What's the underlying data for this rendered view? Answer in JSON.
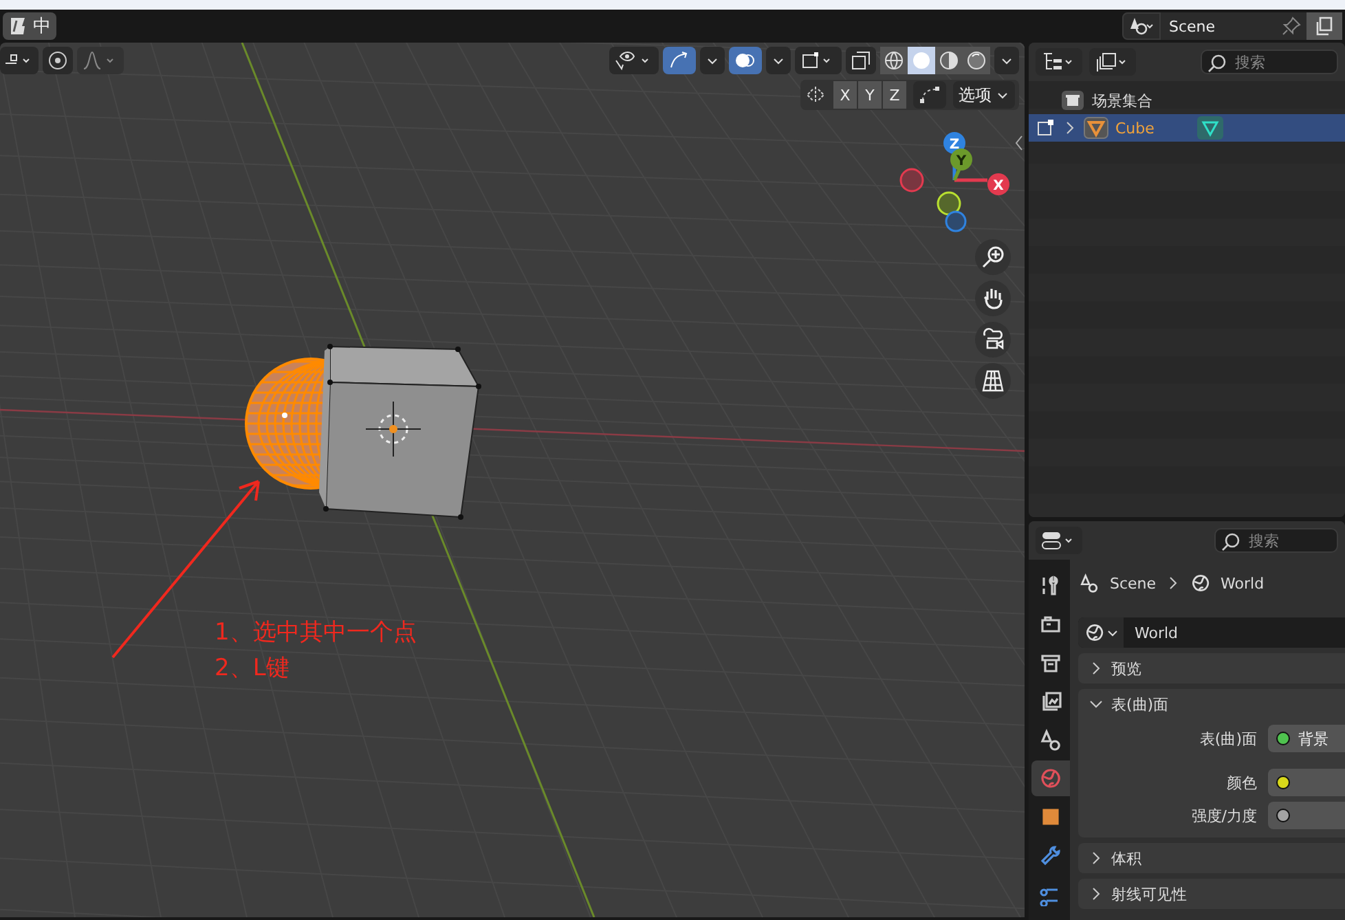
{
  "top_bar": {
    "workspace_label": "中",
    "scene": {
      "name": "Scene"
    }
  },
  "viewport": {
    "header": {
      "shading_modes": [
        {
          "kind": "wireframe",
          "selected": false
        },
        {
          "kind": "solid",
          "selected": true
        },
        {
          "kind": "material",
          "selected": false
        },
        {
          "kind": "rendered",
          "selected": false
        }
      ],
      "axis_buttons": [
        "X",
        "Y",
        "Z"
      ],
      "options_menu": "选项"
    },
    "gizmo_axes": [
      {
        "kind": "z",
        "label": "Z"
      },
      {
        "kind": "y",
        "label": "Y"
      },
      {
        "kind": "neg_x"
      },
      {
        "kind": "x",
        "label": "X"
      },
      {
        "kind": "neg_y"
      },
      {
        "kind": "neg_z"
      }
    ],
    "annotation": {
      "lines": [
        "1、选中其中一个点",
        "2、L键"
      ]
    }
  },
  "outliner": {
    "search": {
      "placeholder": "搜索"
    },
    "items": [
      {
        "label": "场景集合",
        "selected": false,
        "children": [
          {
            "label": "Cube",
            "selected": true
          }
        ]
      }
    ]
  },
  "properties": {
    "search": {
      "placeholder": "搜索"
    },
    "breadcrumb": [
      "Scene",
      "World"
    ],
    "world_field": "World",
    "tabs": [
      {
        "kind": "tool",
        "selected": false
      },
      {
        "kind": "render",
        "selected": false
      },
      {
        "kind": "output",
        "selected": false
      },
      {
        "kind": "view_layer",
        "selected": false
      },
      {
        "kind": "scene",
        "selected": false
      },
      {
        "kind": "world",
        "selected": true
      },
      {
        "kind": "object",
        "selected": false
      },
      {
        "kind": "modifier",
        "selected": false
      },
      {
        "kind": "particles",
        "selected": false
      }
    ],
    "panels": [
      {
        "title": "预览",
        "expanded": false
      },
      {
        "title": "表(曲)面",
        "expanded": true,
        "fields": [
          {
            "label": "表(曲)面",
            "value": "背景",
            "color": "#4fc24f"
          },
          {
            "label": "颜色",
            "color": "#d8d81a"
          },
          {
            "label": "强度/力度",
            "color": "#a3a3a3"
          }
        ]
      },
      {
        "title": "体积",
        "expanded": false
      },
      {
        "title": "射线可见性",
        "expanded": false
      }
    ]
  }
}
